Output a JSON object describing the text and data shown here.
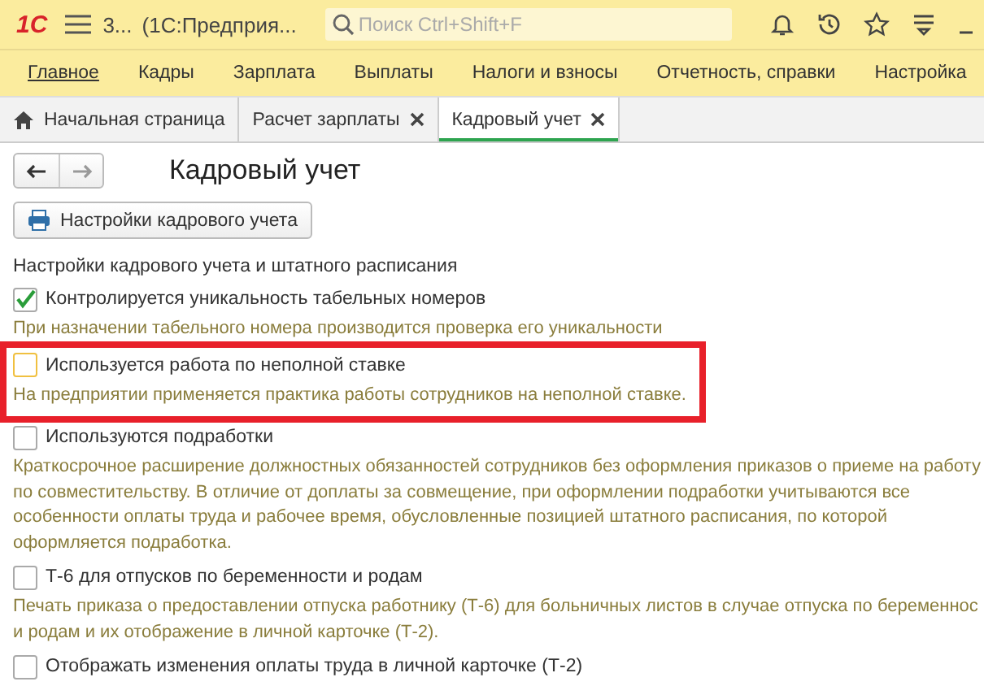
{
  "header": {
    "logo": "1С",
    "title": "3...",
    "subtitle": "(1С:Предприя...",
    "search": {
      "placeholder": "Поиск Ctrl+Shift+F"
    }
  },
  "menu": [
    {
      "label": "Главное",
      "selected": true
    },
    {
      "label": "Кадры",
      "selected": false
    },
    {
      "label": "Зарплата",
      "selected": false
    },
    {
      "label": "Выплаты",
      "selected": false
    },
    {
      "label": "Налоги и взносы",
      "selected": false
    },
    {
      "label": "Отчетность, справки",
      "selected": false
    },
    {
      "label": "Настройка",
      "selected": false
    }
  ],
  "tabs": [
    {
      "label": "Начальная страница",
      "kind": "home",
      "selected": false
    },
    {
      "label": "Расчет зарплаты",
      "kind": "closable",
      "selected": false
    },
    {
      "label": "Кадровый учет",
      "kind": "closable",
      "selected": true
    }
  ],
  "form": {
    "title": "Кадровый учет",
    "settings_button": "Настройки кадрового учета",
    "section": "Настройки кадрового учета и штатного расписания",
    "options": [
      {
        "label": "Контролируется уникальность табельных номеров",
        "checked": true,
        "highlighted": false,
        "description": [
          "При назначении табельного номера производится проверка его уникальности"
        ]
      },
      {
        "label": "Используется работа по неполной ставке",
        "checked": false,
        "highlighted": true,
        "description": [
          "На предприятии применяется практика работы сотрудников на неполной ставке."
        ]
      },
      {
        "label": "Используются подработки",
        "checked": false,
        "highlighted": false,
        "description": [
          "Краткосрочное расширение должностных обязанностей сотрудников без оформления приказов о приеме на работу",
          "по совместительству. В отличие от доплаты за совмещение, при оформлении подработки учитываются все",
          "особенности оплаты труда и рабочее время, обусловленные позицией штатного расписания, по которой",
          "оформляется подработка."
        ]
      },
      {
        "label": "Т-6 для отпусков по беременности и родам",
        "checked": false,
        "highlighted": false,
        "description": [
          "Печать приказа о предоставлении отпуска работнику (Т-6) для больничных листов в случае отпуска по беременнос",
          "и родам и их отображение в личной карточке (Т-2)."
        ]
      },
      {
        "label": "Отображать изменения оплаты труда в личной карточке (Т-2)",
        "checked": false,
        "highlighted": false
      }
    ]
  }
}
